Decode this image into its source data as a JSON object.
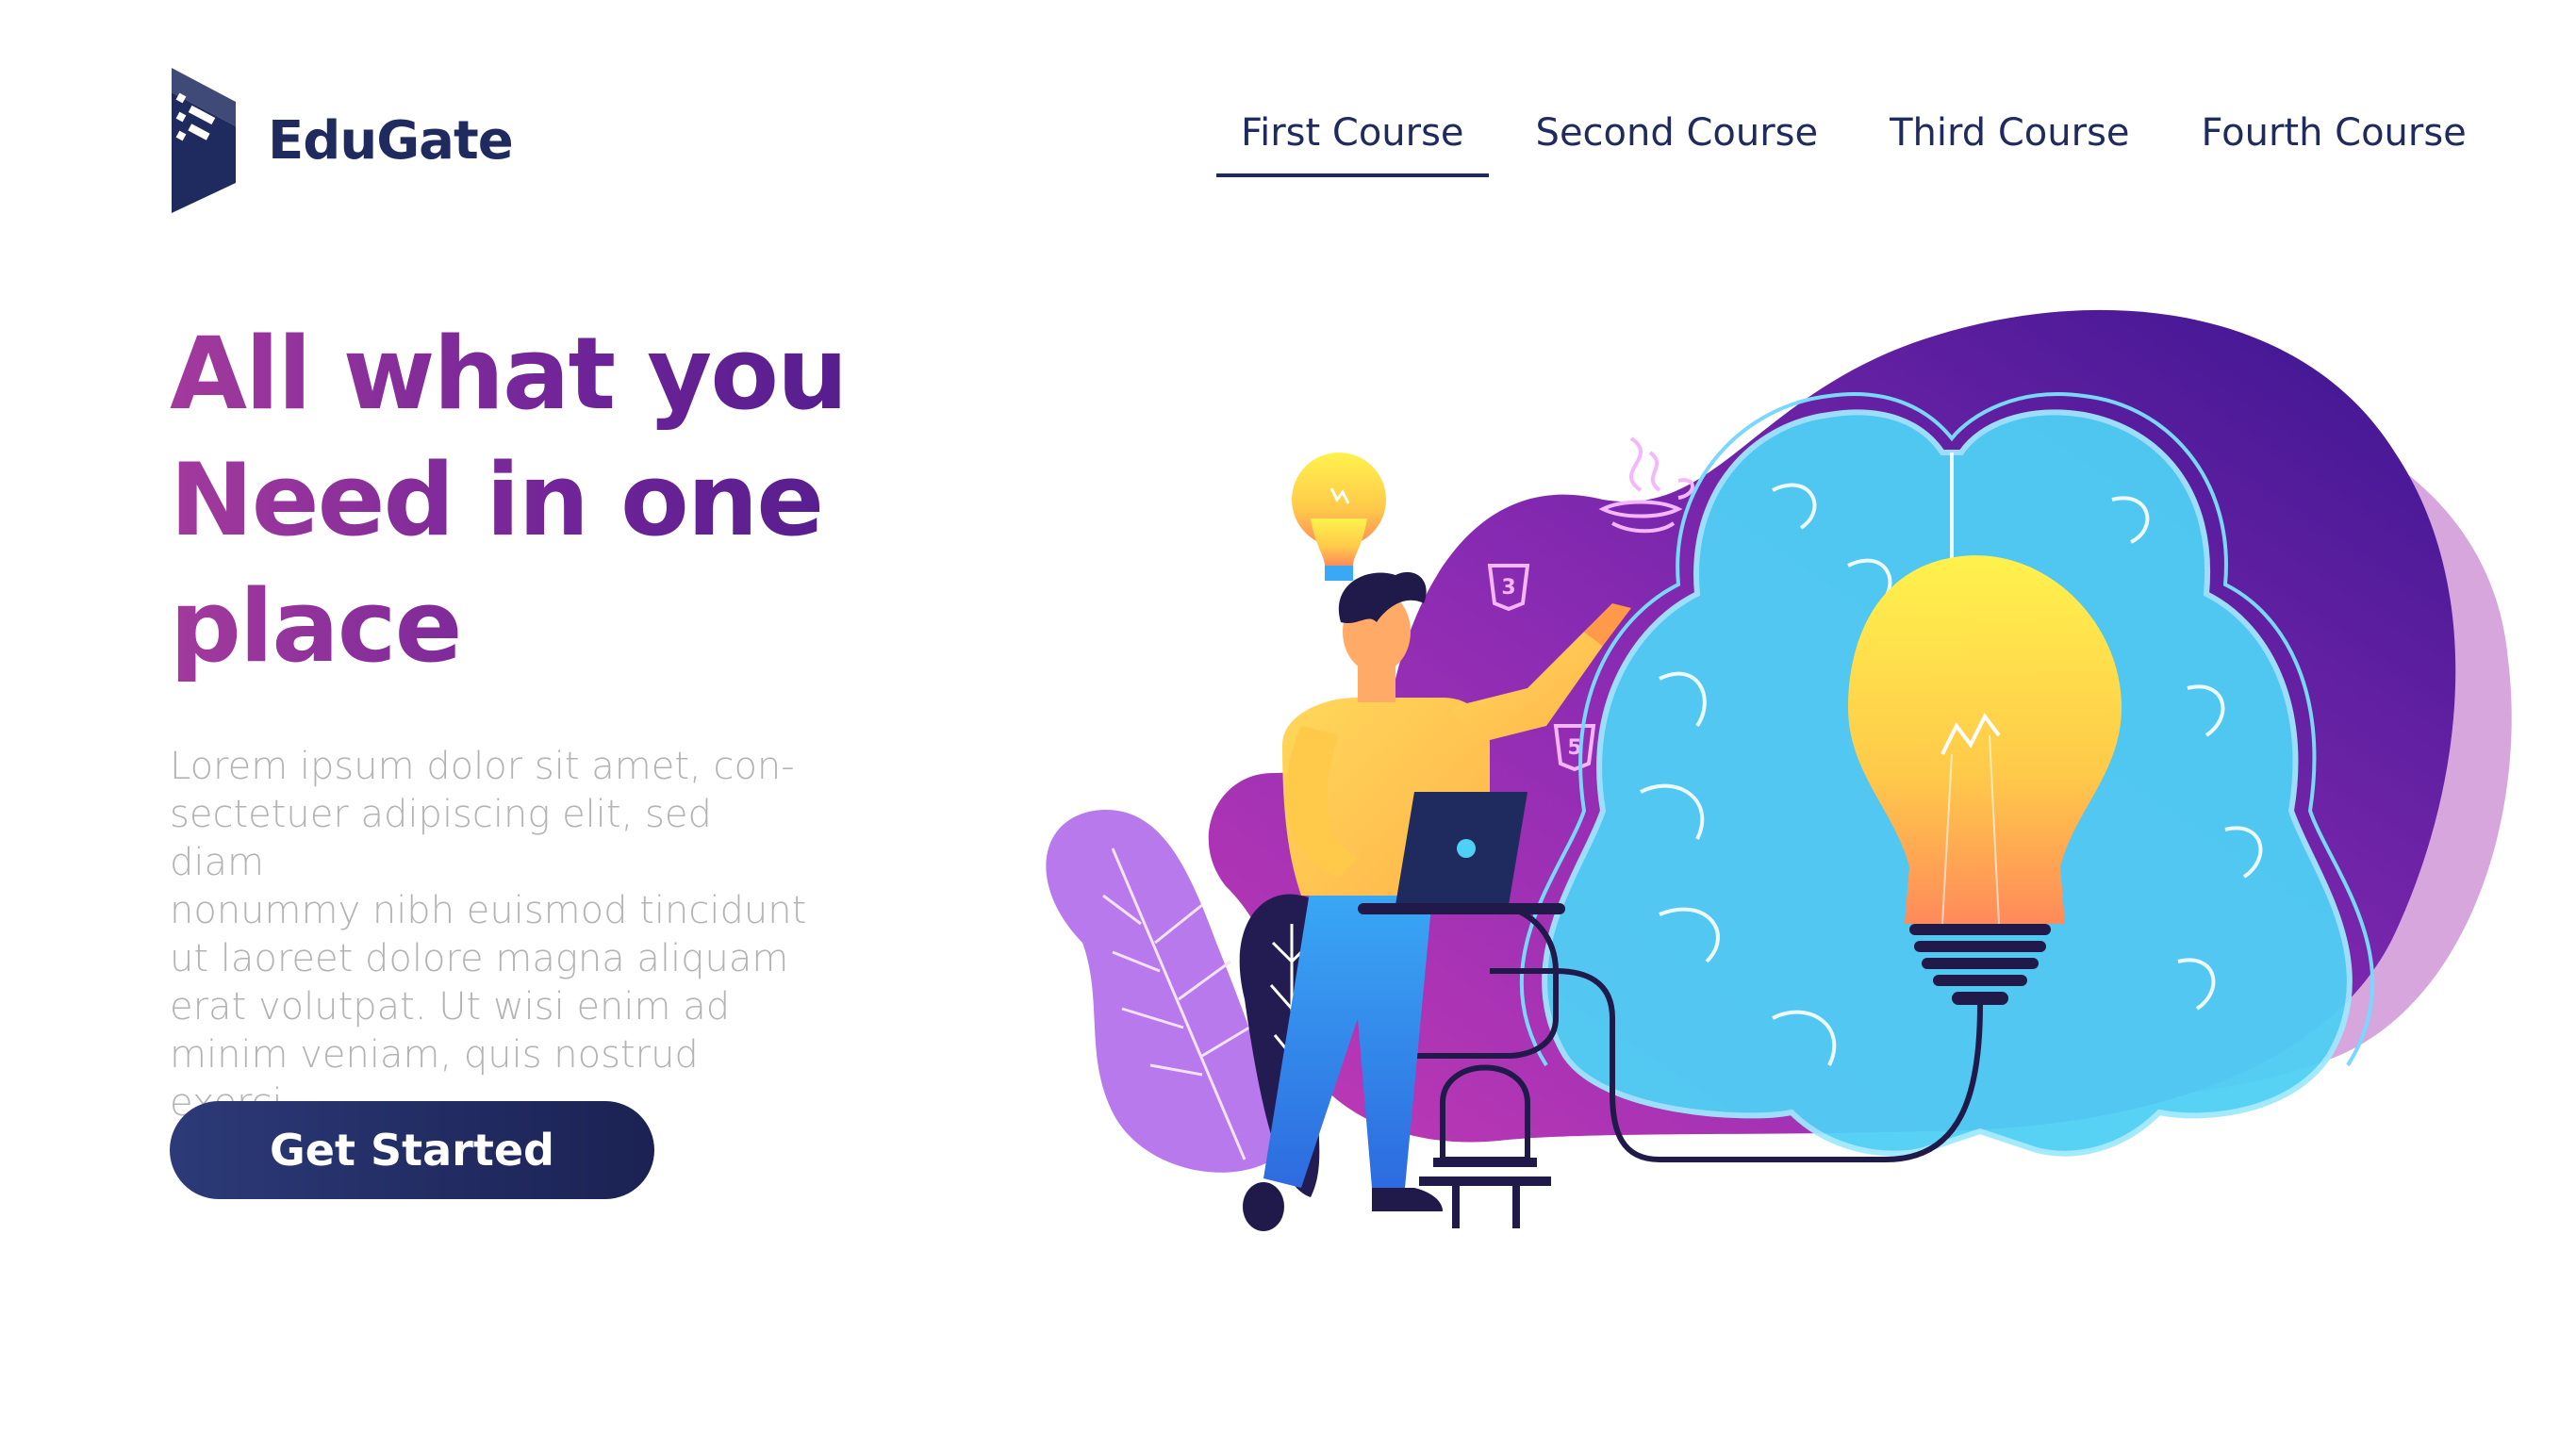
{
  "brand": {
    "name": "EduGate"
  },
  "nav": {
    "items": [
      {
        "label": "First Course",
        "active": true
      },
      {
        "label": "Second Course",
        "active": false
      },
      {
        "label": "Third Course",
        "active": false
      },
      {
        "label": "Fourth Course",
        "active": false
      }
    ]
  },
  "hero": {
    "headline_line1": "All what you",
    "headline_line2": "Need in one",
    "headline_line3": "place",
    "body": "Lorem ipsum dolor sit amet, con-sectetuer adipiscing elit, sed diam nonummy nibh euismod tincidunt ut laoreet dolore magna aliquam erat volutpat. Ut wisi enim ad minim veniam, quis nostrud exerci",
    "body_lines": [
      "Lorem ipsum dolor sit amet, con-",
      "sectetuer adipiscing elit, sed diam",
      "nonummy nibh euismod tincidunt",
      "ut laoreet dolore magna aliquam",
      "erat volutpat. Ut wisi enim ad",
      "minim veniam, quis nostrud exerci"
    ],
    "cta_label": "Get Started"
  },
  "colors": {
    "navy": "#1f2a5e",
    "headline_start": "#a33a9d",
    "headline_end": "#4d1c8a",
    "blob_purple": "#6a1fa8",
    "brain_blue": "#4fc8f2",
    "bulb_yellow": "#ffe94a",
    "body_gray": "#b3b3b3"
  },
  "illustration": {
    "icons": [
      "lightbulb-icon",
      "java-icon",
      "css3-icon",
      "html5-icon",
      "brain-icon",
      "laptop-icon",
      "plug-icon"
    ]
  }
}
